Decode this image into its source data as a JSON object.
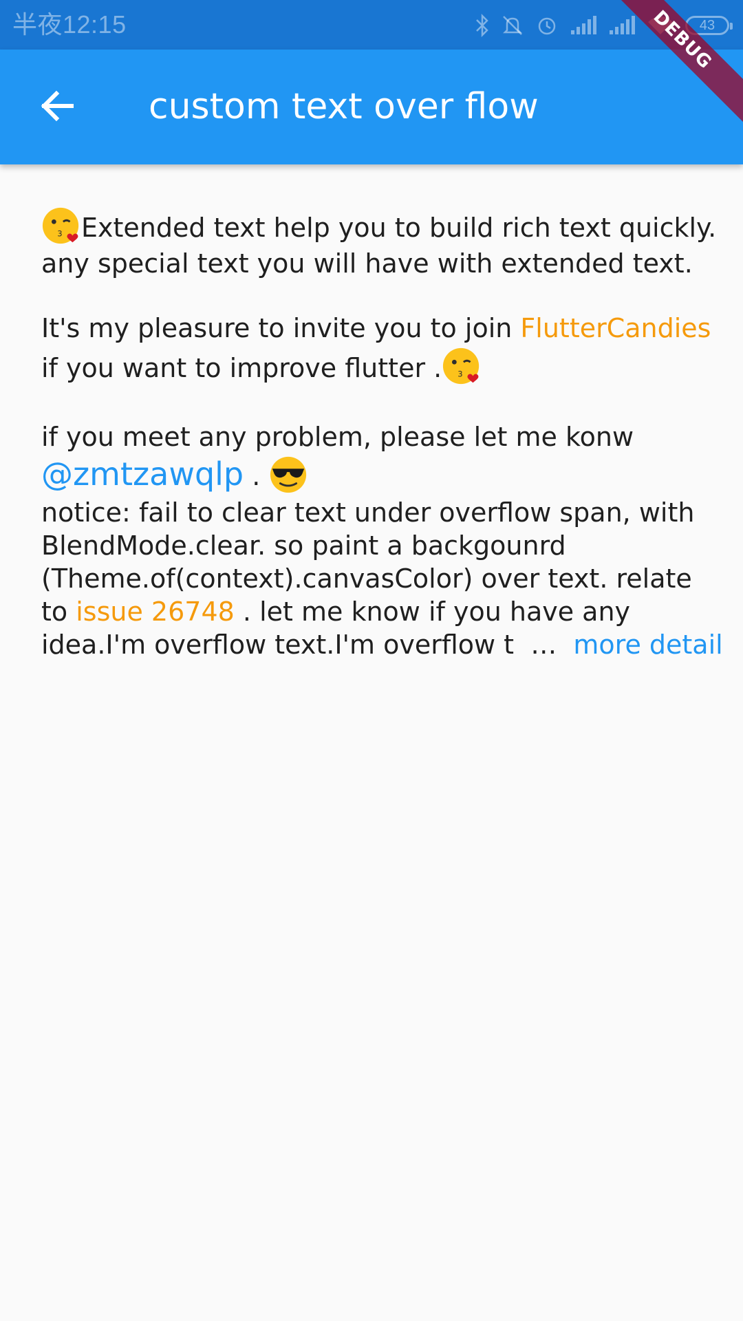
{
  "status_bar": {
    "time": "半夜12:15",
    "battery": "43",
    "icons": [
      "bluetooth-icon",
      "mute-icon",
      "alarm-icon",
      "signal-icon",
      "signal-icon",
      "wifi-icon",
      "battery-icon"
    ]
  },
  "app_bar": {
    "title": "custom text over flow",
    "back_icon": "arrow-back-icon",
    "color": "#2196f3"
  },
  "debug_banner": "DEBUG",
  "content": {
    "paragraph1": {
      "line1": "Extended text help you to build rich text quickly.",
      "line2": "any special text you will have with extended text."
    },
    "paragraph2": {
      "line1_text": "It's my pleasure to invite you to join ",
      "line1_link": "FlutterCandies",
      "line2_text": "if you want to improve flutter ."
    },
    "paragraph3": {
      "line1": "if you meet any problem, please let me konw",
      "mention": "@zmtzawqlp",
      "mention_suffix": " .",
      "line3": " notice: fail to clear text under overflow span, with",
      "line4": "BlendMode.clear. so paint a backgounrd",
      "line5": "(Theme.of(context).canvasColor) over text. relate",
      "line6_prefix": "to ",
      "line6_link": "issue 26748",
      "line6_suffix": " . let me know if you have any",
      "line7_text": "idea.I'm overflow text.I'm overflow t",
      "ellipsis": "  …  ",
      "more_detail": "more detail"
    },
    "emojis": [
      "kiss-wink-emoji",
      "kiss-wink-emoji",
      "sunglasses-emoji"
    ]
  },
  "colors": {
    "link_orange": "#f59a0c",
    "link_blue": "#2196f3",
    "text": "#1f1f1f",
    "background": "#fafafa",
    "status_bar": "#1976d2"
  }
}
